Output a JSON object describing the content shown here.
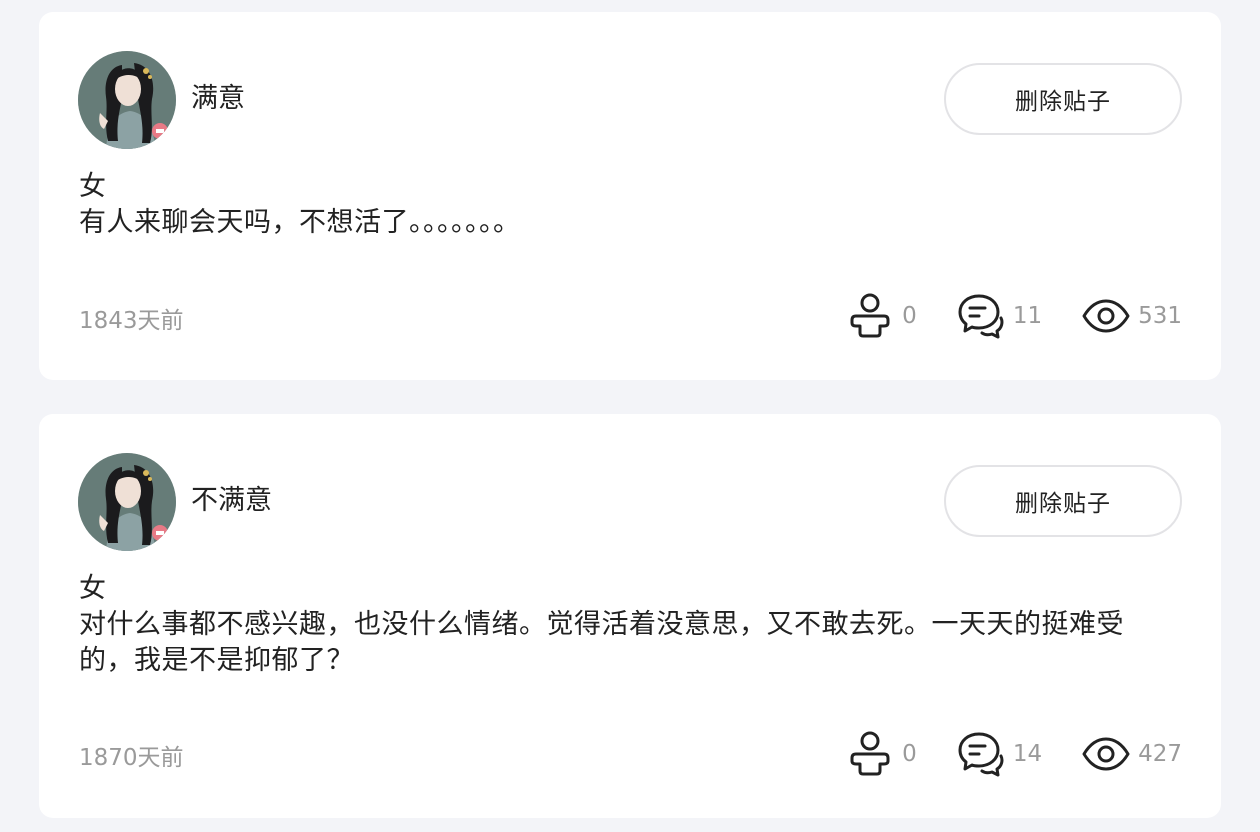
{
  "posts": [
    {
      "username": "满意",
      "delete_label": "删除贴子",
      "gender": "女",
      "text": "有人来聊会天吗，不想活了。。。。。。。",
      "time": "1843天前",
      "likes": "0",
      "comments": "11",
      "views": "531"
    },
    {
      "username": "不满意",
      "delete_label": "删除贴子",
      "gender": "女",
      "text": "对什么事都不感兴趣，也没什么情绪。觉得活着没意思，又不敢去死。一天天的挺难受的，我是不是抑郁了？",
      "time": "1870天前",
      "likes": "0",
      "comments": "14",
      "views": "427"
    }
  ],
  "icons": {
    "like": "person-icon",
    "comment": "comment-bubble-icon",
    "view": "eye-icon"
  },
  "colors": {
    "background": "#f3f4f8",
    "card": "#ffffff",
    "text": "#222222",
    "muted": "#9a9a9a",
    "button_border": "#e3e3e6"
  }
}
